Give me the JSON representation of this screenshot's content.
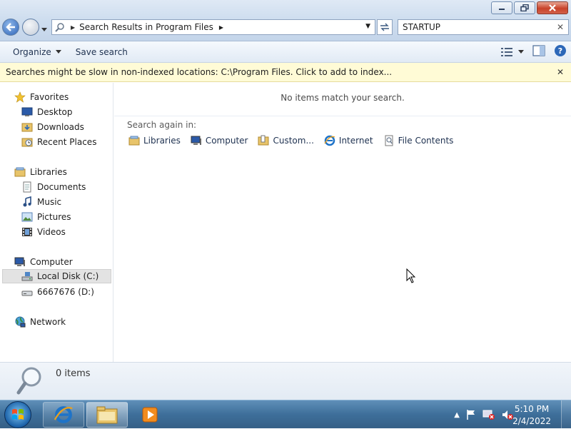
{
  "window": {
    "controls": {
      "minimize_icon": "minimize-icon",
      "restore_icon": "restore-icon",
      "close_icon": "close-icon"
    }
  },
  "address_bar": {
    "breadcrumb": "Search Results in Program Files"
  },
  "search": {
    "value": "STARTUP"
  },
  "toolbar": {
    "organize_label": "Organize",
    "save_search_label": "Save search"
  },
  "infobar": {
    "message": "Searches might be slow in non-indexed locations: C:\\Program Files. Click to add to index..."
  },
  "sidebar": {
    "favorites": {
      "label": "Favorites",
      "items": [
        {
          "label": "Desktop"
        },
        {
          "label": "Downloads"
        },
        {
          "label": "Recent Places"
        }
      ]
    },
    "libraries": {
      "label": "Libraries",
      "items": [
        {
          "label": "Documents"
        },
        {
          "label": "Music"
        },
        {
          "label": "Pictures"
        },
        {
          "label": "Videos"
        }
      ]
    },
    "computer": {
      "label": "Computer",
      "items": [
        {
          "label": "Local Disk (C:)",
          "selected": true
        },
        {
          "label": "6667676 (D:)"
        }
      ]
    },
    "network": {
      "label": "Network"
    }
  },
  "main": {
    "empty_message": "No items match your search.",
    "search_again_label": "Search again in:",
    "search_again_items": [
      {
        "label": "Libraries"
      },
      {
        "label": "Computer"
      },
      {
        "label": "Custom..."
      },
      {
        "label": "Internet"
      },
      {
        "label": "File Contents"
      }
    ]
  },
  "details": {
    "count_label": "0 items"
  },
  "taskbar": {
    "clock_time": "5:10 PM",
    "clock_date": "2/4/2022"
  },
  "colors": {
    "infobar_bg": "#fffbd6",
    "selection_bg": "#e3e3e3",
    "taskbar_bg": "#3e6f9a"
  }
}
